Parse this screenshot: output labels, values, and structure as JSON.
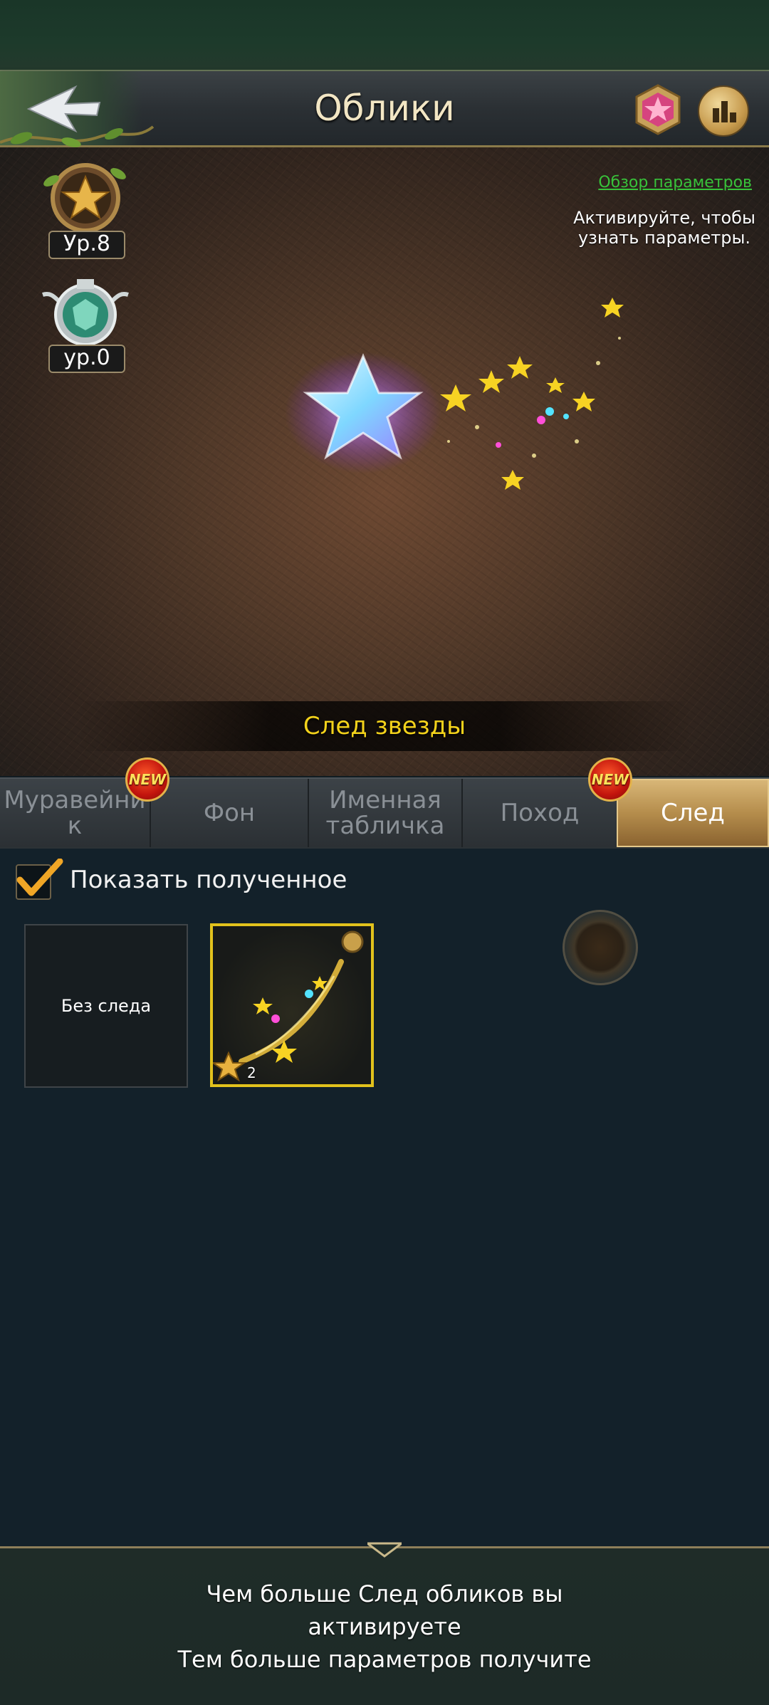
{
  "header": {
    "title": "Облики",
    "back_icon": "back-arrow-icon",
    "gem_icon": "pink-crystal-icon",
    "rank_icon": "leaderboard-icon"
  },
  "badges": {
    "star_level": "Ур.8",
    "shield_level": "ур.0"
  },
  "preview": {
    "stats_link": "Обзор параметров",
    "activate_hint": "Активируйте, чтобы узнать параметры.",
    "trail_name": "След звезды"
  },
  "tabs": [
    {
      "label": "Муравейни к",
      "new": true,
      "active": false
    },
    {
      "label": "Фон",
      "new": false,
      "active": false
    },
    {
      "label": "Именная табличка",
      "new": false,
      "active": false
    },
    {
      "label": "Поход",
      "new": true,
      "active": false
    },
    {
      "label": "След",
      "new": false,
      "active": true
    }
  ],
  "new_badge_text": "NEW",
  "filter": {
    "show_owned_label": "Показать полученное",
    "checked": true
  },
  "slots": {
    "none_label": "Без следа",
    "star_trail_count": "2"
  },
  "footer": {
    "line1": "Чем больше След обликов вы",
    "line2": "активируете",
    "line3": "Тем больше параметров получите"
  },
  "colors": {
    "accent_gold": "#e2c21c",
    "trail_name": "#f3d21b",
    "link_green": "#38c23a"
  }
}
